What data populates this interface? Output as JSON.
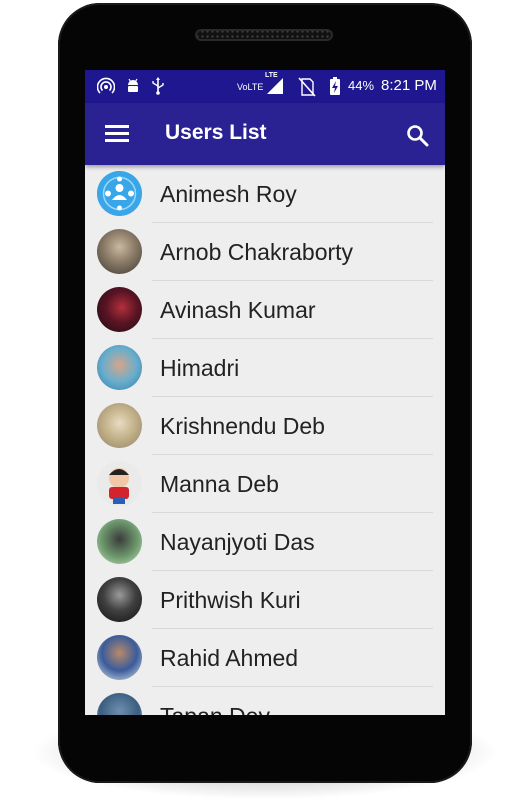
{
  "status_bar": {
    "volte": "VoLTE",
    "lte": "LTE",
    "battery": "44%",
    "time": "8:21 PM"
  },
  "toolbar": {
    "title": "Users List",
    "menu_icon": "hamburger-menu-icon",
    "search_icon": "search-icon"
  },
  "colors": {
    "status_bar": "#1f178f",
    "toolbar": "#2a2293",
    "list_bg": "#eeeeee"
  },
  "users": [
    {
      "name": "Animesh Roy",
      "avatar": "app-logo"
    },
    {
      "name": "Arnob Chakraborty",
      "avatar": "photo"
    },
    {
      "name": "Avinash Kumar",
      "avatar": "photo"
    },
    {
      "name": "Himadri",
      "avatar": "photo"
    },
    {
      "name": "Krishnendu Deb",
      "avatar": "photo"
    },
    {
      "name": "Manna Deb",
      "avatar": "cartoon"
    },
    {
      "name": "Nayanjyoti Das",
      "avatar": "photo"
    },
    {
      "name": "Prithwish Kuri",
      "avatar": "photo"
    },
    {
      "name": "Rahid Ahmed",
      "avatar": "photo"
    },
    {
      "name": "Tapan Dey",
      "avatar": "photo"
    }
  ]
}
